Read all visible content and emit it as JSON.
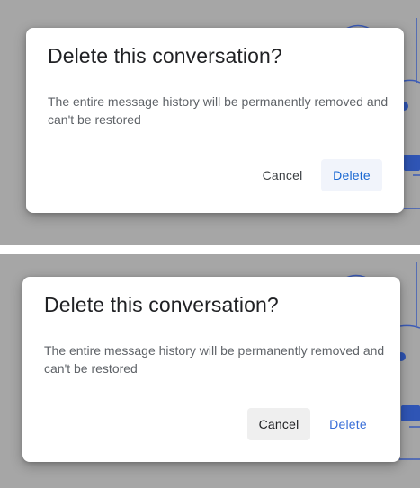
{
  "states": [
    {
      "title": "Delete this conversation?",
      "message": "The entire message history will be permanently removed and can't be restored",
      "cancel_label": "Cancel",
      "delete_label": "Delete",
      "focused_button": "delete"
    },
    {
      "title": "Delete this conversation?",
      "message": "The entire message history will be permanently removed and can't be restored",
      "cancel_label": "Cancel",
      "delete_label": "Delete",
      "focused_button": "cancel"
    }
  ],
  "colors": {
    "scrim": "#a6a6a6",
    "accent": "#1a73e8",
    "dialog_bg": "#ffffff"
  }
}
